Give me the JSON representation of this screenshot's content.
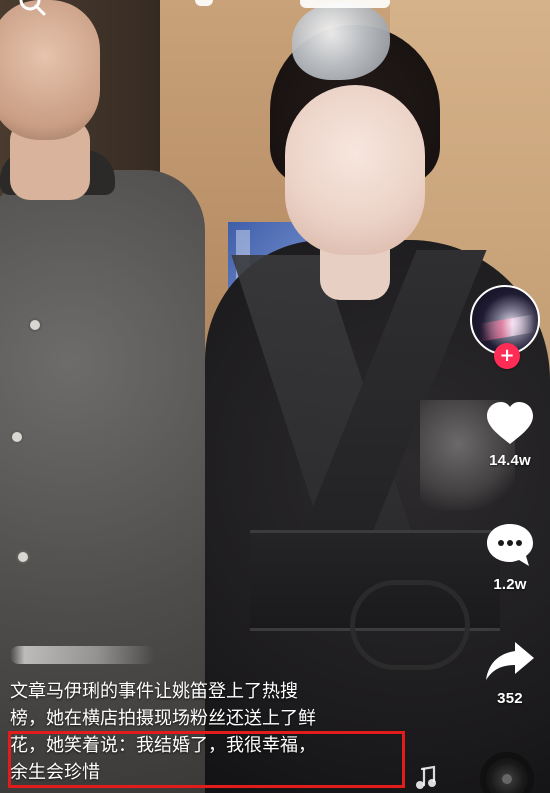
{
  "screen": {
    "top_overlay": {
      "search_icon": "search-icon"
    }
  },
  "right_rail": {
    "avatar": {
      "follow_icon": "plus-icon",
      "follow_symbol": "+"
    },
    "like": {
      "icon": "heart-icon",
      "count": "14.4w"
    },
    "comment": {
      "icon": "comment-icon",
      "count": "1.2w"
    },
    "share": {
      "icon": "share-icon",
      "count": "352"
    },
    "music": {
      "icon": "music-note-icon"
    }
  },
  "caption": {
    "line1": "文章马伊琍的事件让姚笛登上了热搜",
    "line2": "榜，她在横店拍摄现场粉丝还送上了鲜",
    "line3": "花，她笑着说：我结婚了，我很幸福，",
    "line4": "余生会珍惜"
  },
  "colors": {
    "highlight_border": "#e21b1b",
    "follow_plus": "#ff2d55"
  }
}
